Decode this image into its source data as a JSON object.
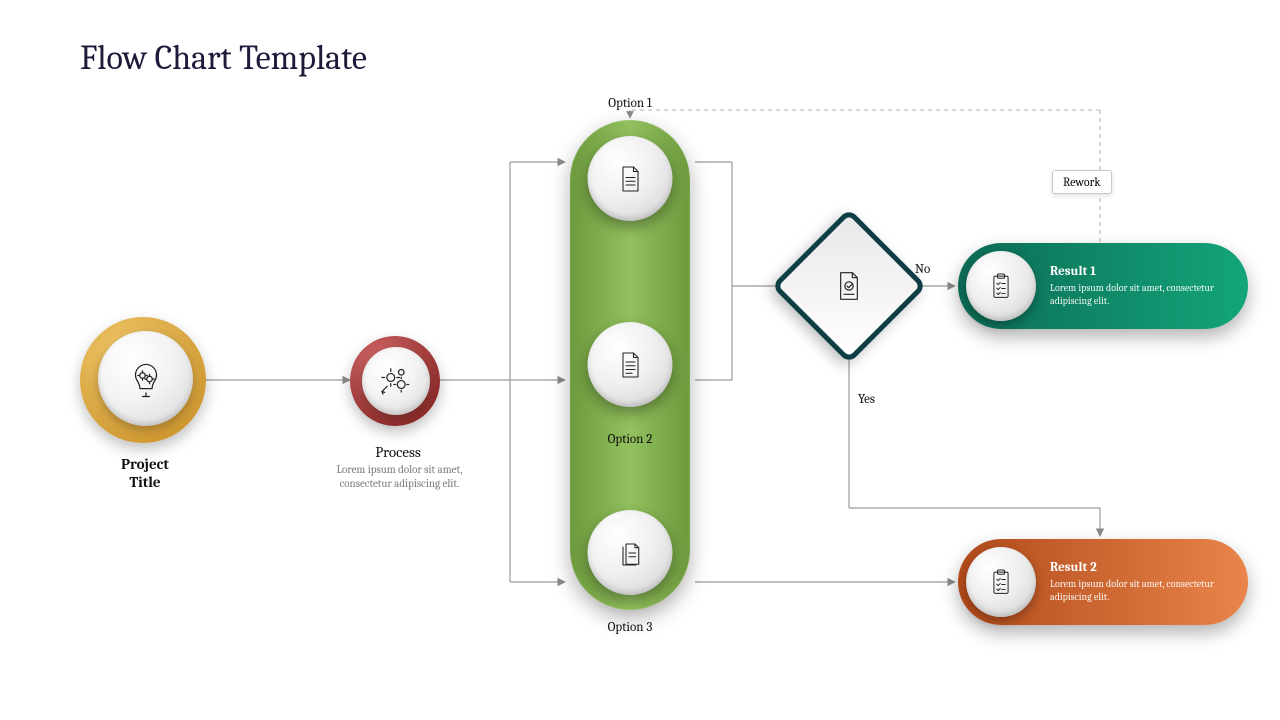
{
  "title": "Flow Chart Template",
  "project": {
    "label": "Project\nTitle"
  },
  "process": {
    "label": "Process",
    "desc": "Lorem ipsum dolor sit amet, consectetur adipiscing elit."
  },
  "options": {
    "top_label": "Option 1",
    "mid_label": "Option 2",
    "bot_label": "Option 3"
  },
  "decision": {
    "no_label": "No",
    "yes_label": "Yes"
  },
  "rework": {
    "label": "Rework"
  },
  "result1": {
    "title": "Result 1",
    "desc": "Lorem ipsum dolor sit amet, consectetur adipiscing elit."
  },
  "result2": {
    "title": "Result 2",
    "desc": "Lorem ipsum dolor sit amet, consectetur adipiscing elit."
  },
  "colors": {
    "project_ring": "#d49a2a",
    "process_ring": "#a82a2a",
    "options_body": "#7fb24a",
    "decision_border": "#0f3d45",
    "result1": "#0f8566",
    "result2": "#d46a2a"
  }
}
